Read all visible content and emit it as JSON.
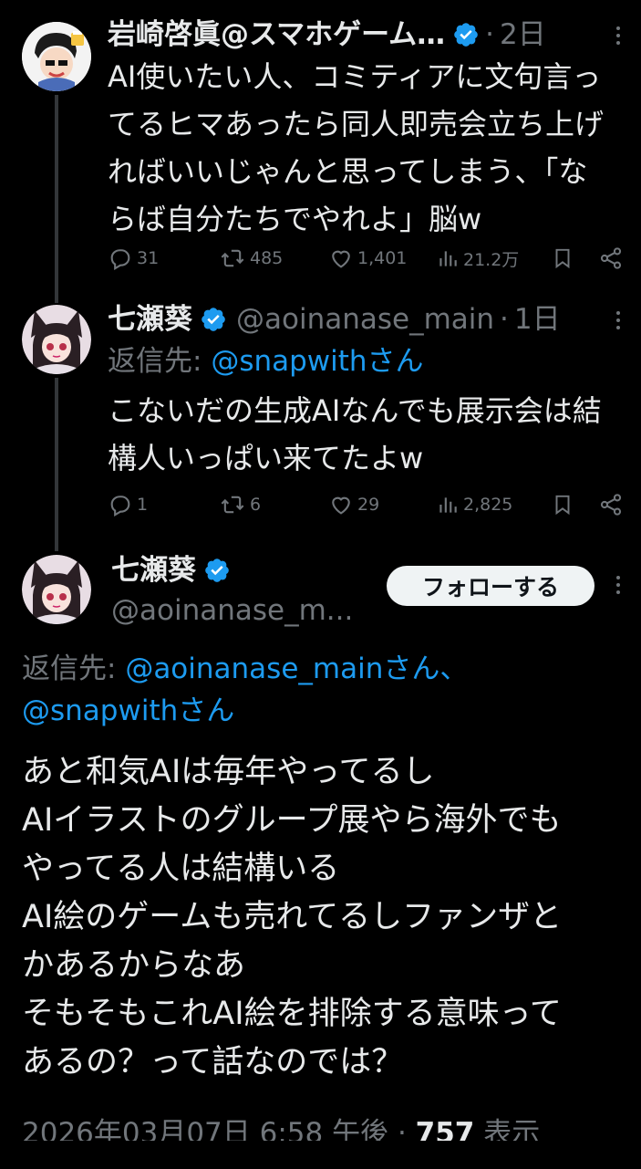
{
  "tweets": [
    {
      "name": "岩崎啓眞@スマホゲーム…",
      "time": "2日",
      "text": "AI使いたい人、コミティアに文句言っ\nてるヒマあったら同人即売会立ち上げ\nればいいじゃんと思ってしまう、「な\nらば自分たちでやれよ」脳w",
      "replies": "31",
      "retweets": "485",
      "likes": "1,401",
      "views": "21.2万"
    },
    {
      "name": "七瀬葵",
      "handle": "@aoinanase_main",
      "time": "1日",
      "reply_prefix": "返信先: ",
      "reply_mention": "@snapwithさん",
      "text": "こないだの生成AIなんでも展示会は結\n構人いっぱい来てたよw",
      "replies": "1",
      "retweets": "6",
      "likes": "29",
      "views": "2,825"
    }
  ],
  "main": {
    "name": "七瀬葵",
    "handle": "@aoinanase_m...",
    "follow_label": "フォローする",
    "reply_prefix": "返信先: ",
    "reply_mention_1": "@aoinanase_mainさん、",
    "reply_mention_2": "@snapwithさん",
    "text": "あと和気AIは毎年やってるし\nAIイラストのグループ展やら海外でも\nやってる人は結構いる\nAI絵のゲームも売れてるしファンザと\nかあるからなあ\nそもそもこれAI絵を排除する意味って\nあるの？って話なのでは？",
    "timestamp": "2026年03月07日 6:58 午後 · ",
    "views_count": "757",
    "views_label": " 表示"
  },
  "colors": {
    "background": "#000000",
    "text": "#e7e9ea",
    "secondary": "#71767b",
    "accent": "#1d9bf0",
    "verified": "#1d9bf0"
  },
  "icons": [
    "reply-icon",
    "retweet-icon",
    "like-icon",
    "views-icon",
    "bookmark-icon",
    "share-icon",
    "verified-icon",
    "more-icon"
  ]
}
